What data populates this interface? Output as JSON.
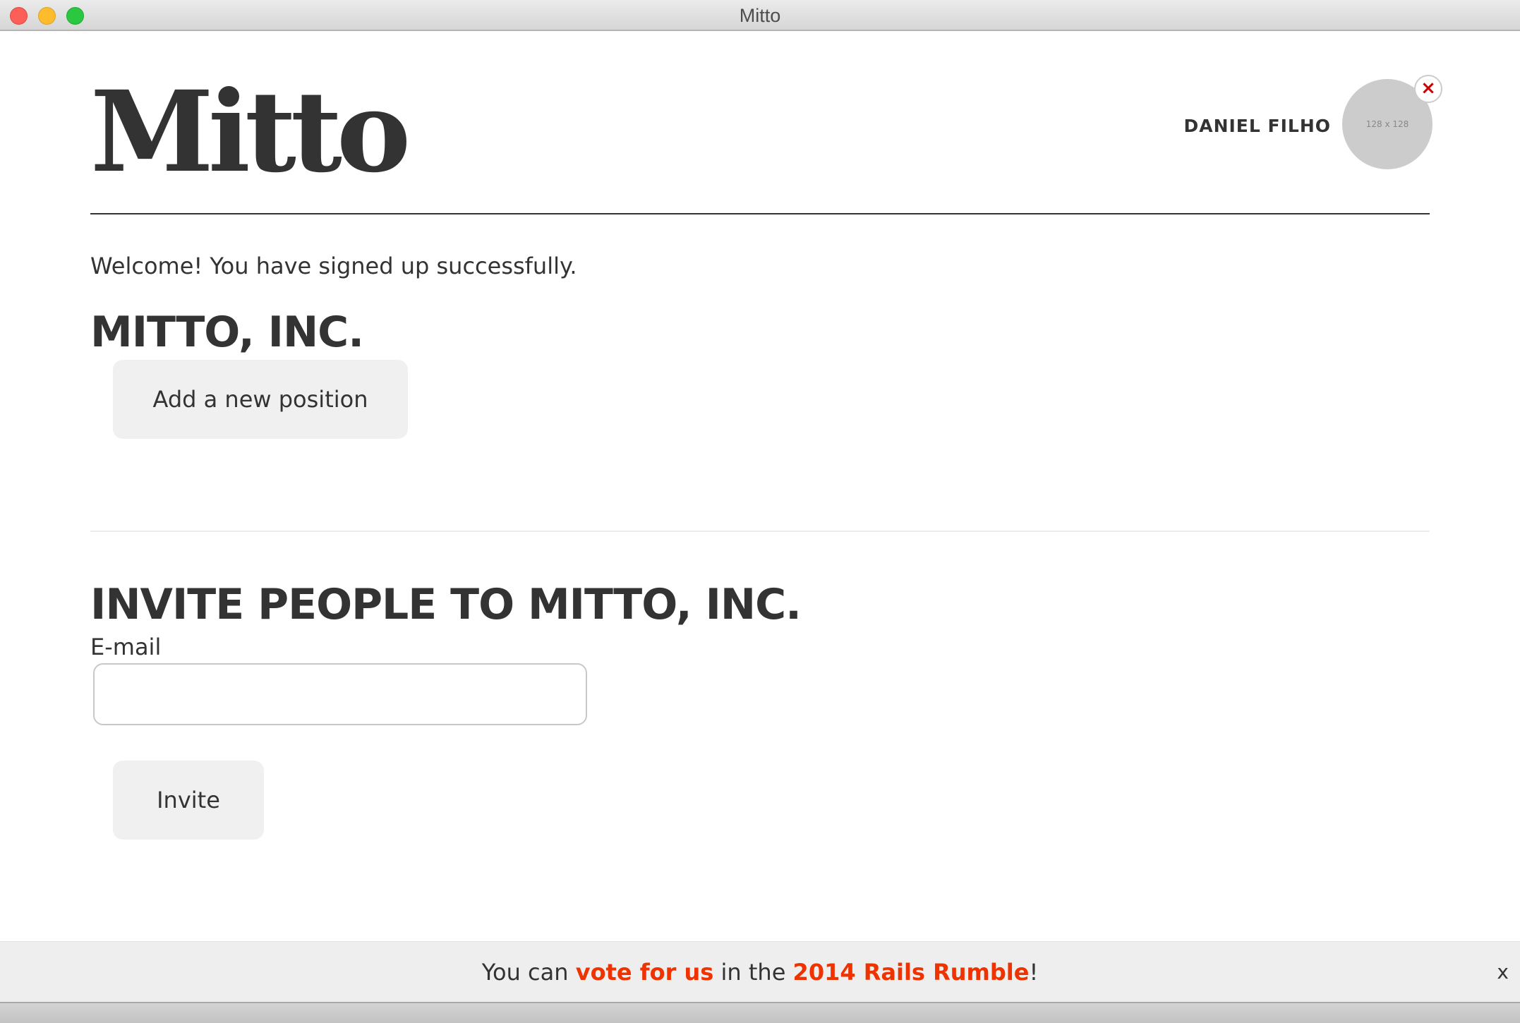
{
  "window": {
    "title": "Mitto"
  },
  "header": {
    "logo": "Mitto",
    "user_name": "DANIEL FILHO",
    "avatar_placeholder": "128 x 128",
    "remove_avatar": "×"
  },
  "flash": {
    "message": "Welcome! You have signed up successfully."
  },
  "company": {
    "heading": "MITTO, INC.",
    "add_position_label": "Add a new position"
  },
  "invite": {
    "heading": "INVITE PEOPLE TO MITTO, INC.",
    "email_label": "E-mail",
    "email_value": "",
    "invite_label": "Invite"
  },
  "banner": {
    "text_before": "You can ",
    "link1": "vote for us",
    "text_middle": " in the ",
    "link2": "2014 Rails Rumble",
    "text_after": "!",
    "close": "x"
  },
  "colors": {
    "link": "#ee3300",
    "text": "#333333",
    "button_bg": "#f0f0f0"
  }
}
